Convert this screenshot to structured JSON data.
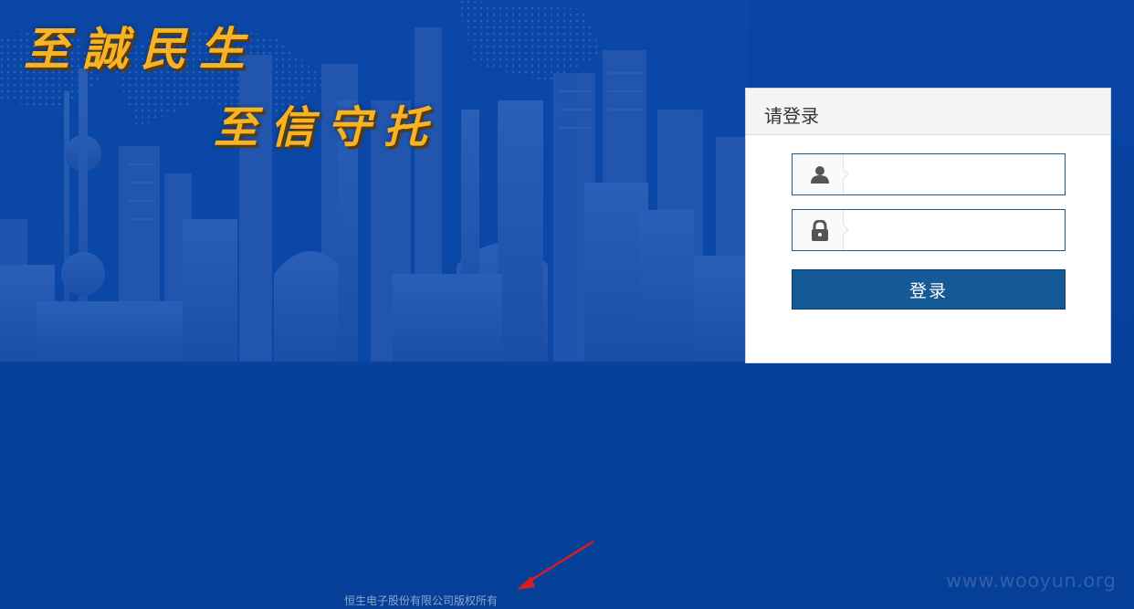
{
  "slogan": {
    "line1": "至誠民生",
    "line2": "至信守托"
  },
  "login": {
    "title": "请登录",
    "username": {
      "value": "",
      "icon": "user-icon"
    },
    "password": {
      "value": "",
      "icon": "lock-icon"
    },
    "submit_label": "登录"
  },
  "footer": {
    "copyright": "恒生电子股份有限公司版权所有"
  },
  "watermark": "www.wooyun.org",
  "colors": {
    "background": "#05409a",
    "slogan": "#f6b325",
    "button": "#145a96",
    "arrow": "#d22020"
  }
}
